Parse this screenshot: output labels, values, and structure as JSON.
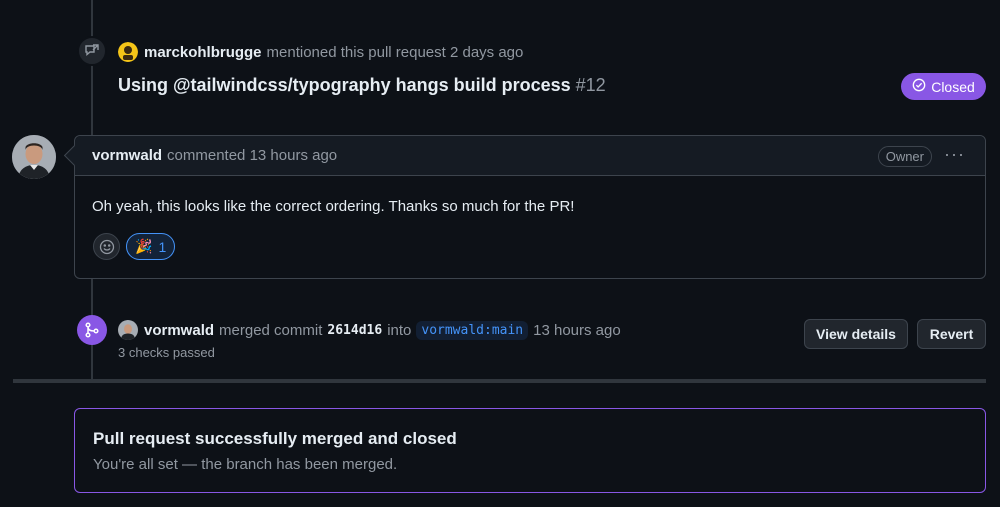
{
  "mention_event": {
    "user": "marckohlbrugge",
    "action_text": "mentioned this pull request 2 days ago",
    "pr_title": "Using @tailwindcss/typography hangs build process",
    "pr_number": "#12",
    "status_label": "Closed",
    "icons": {
      "event": "cross-reference-icon",
      "status": "check-circle-icon"
    }
  },
  "comment": {
    "author": "vormwald",
    "action_text": "commented 13 hours ago",
    "role_badge": "Owner",
    "menu_label": "···",
    "body": "Oh yeah, this looks like the correct ordering. Thanks so much for the PR!",
    "reactions": [
      {
        "emoji": "🎉",
        "count": "1"
      }
    ]
  },
  "merge_event": {
    "user": "vormwald",
    "merged_text": "merged commit",
    "commit_sha": "2614d16",
    "into_text": "into",
    "branch": "vormwald:main",
    "time_text": "13 hours ago",
    "checks_text": "3 checks passed",
    "view_details_label": "View details",
    "revert_label": "Revert"
  },
  "merged_banner": {
    "title": "Pull request successfully merged and closed",
    "subtitle": "You're all set — the branch has been merged."
  },
  "colors": {
    "background": "#0d1117",
    "merged_purple": "#8957e5",
    "link_blue": "#4493f8",
    "border": "#3d444d"
  }
}
